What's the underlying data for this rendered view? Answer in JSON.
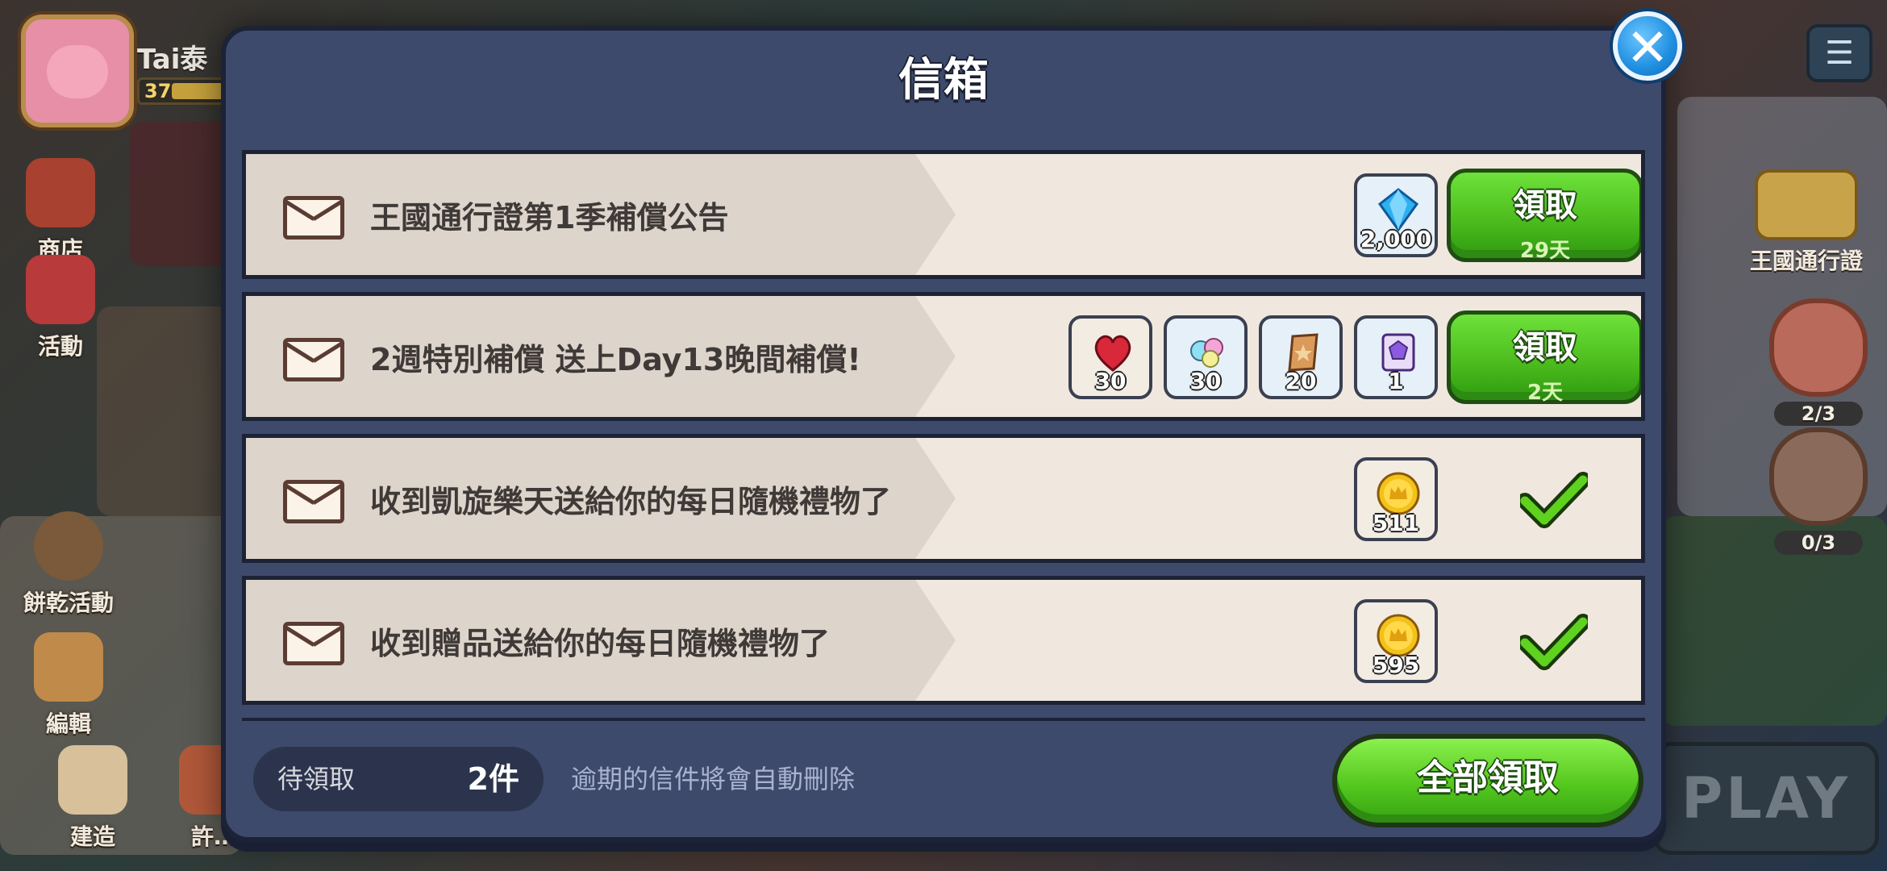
{
  "hud": {
    "player_name": "Tai泰",
    "level": "37",
    "side_menu": [
      {
        "label": "商店"
      },
      {
        "label": "活動"
      },
      {
        "label": "餅乾活動"
      },
      {
        "label": "編輯"
      },
      {
        "label": "建造"
      },
      {
        "label": "許…"
      }
    ],
    "right_menu": {
      "kingdom_pass_label": "王國通行證",
      "house_count": "2/3",
      "worker_count": "0/3",
      "play_label": "PLAY"
    }
  },
  "mailbox": {
    "title": "信箱",
    "mails": [
      {
        "title": "王國通行證第1季補償公告",
        "rewards": [
          {
            "icon": "crystal-icon",
            "qty": "2,000"
          }
        ],
        "status": "claimable",
        "claim_label": "領取",
        "days_left": "29天"
      },
      {
        "title": "2週特別補償 送上Day13晚間補償!",
        "rewards": [
          {
            "icon": "jelly-heart-icon",
            "qty": "30"
          },
          {
            "icon": "candy-icon",
            "qty": "30"
          },
          {
            "icon": "cookie-cutter-icon",
            "qty": "20"
          },
          {
            "icon": "purple-tome-icon",
            "qty": "1"
          }
        ],
        "status": "claimable",
        "claim_label": "領取",
        "days_left": "2天"
      },
      {
        "title": "收到凱旋樂天送給你的每日隨機禮物了",
        "rewards": [
          {
            "icon": "gold-coin-icon",
            "qty": "511"
          }
        ],
        "status": "claimed"
      },
      {
        "title": "收到贈品送給你的每日隨機禮物了",
        "rewards": [
          {
            "icon": "gold-coin-icon",
            "qty": "595"
          }
        ],
        "status": "claimed"
      }
    ],
    "footer": {
      "pending_label": "待領取",
      "pending_count": "2件",
      "note": "逾期的信件將會自動刪除",
      "claim_all_label": "全部領取"
    }
  },
  "colors": {
    "modal_bg": "#3d4a6b",
    "row_bg": "#f0e8df",
    "claim_green": "#4dbd1e",
    "close_blue": "#1f8ee0"
  }
}
